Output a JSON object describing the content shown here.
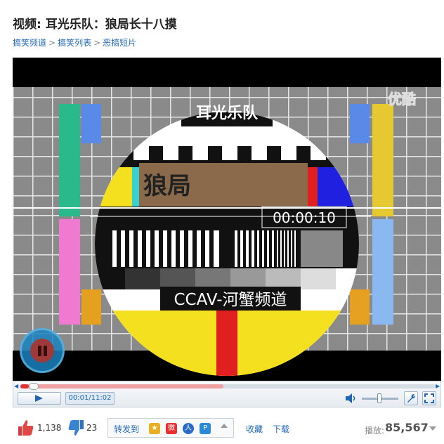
{
  "page": {
    "title": "视频: 耳光乐队：狼局长十八摸",
    "breadcrumbs": [
      "搞笑频道",
      "搞笑列表",
      "恶搞短片"
    ],
    "breadcrumb_separator": ">"
  },
  "video": {
    "watermark": "优酷",
    "banner_text": "耳光乐队",
    "name_plate": "狼局",
    "clock": "00:00:10",
    "channel_caption": "CCAV-河蟹频道"
  },
  "controls": {
    "time_display": "00:01/11:02",
    "progress": 0.02,
    "buffered": 0.49,
    "volume": 0.55,
    "icons": [
      "play-icon",
      "volume-icon",
      "wrench-icon",
      "fullscreen-icon"
    ]
  },
  "actions": {
    "like_count": "1,138",
    "dislike_count": "23",
    "share_label": "转发到",
    "share_icons": [
      "star-icon",
      "weibo-icon",
      "person-icon",
      "p-icon"
    ],
    "favorite_label": "收藏",
    "download_label": "下载",
    "plays_label": "播放:",
    "plays_count": "85,567"
  },
  "colors": {
    "link": "#1f67b4",
    "progress": "#dd3333",
    "accent_blue": "#1982be"
  }
}
